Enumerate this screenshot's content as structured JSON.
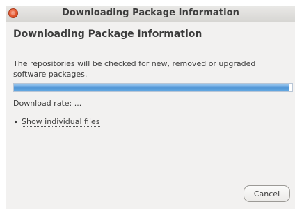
{
  "window": {
    "title": "Downloading Package Information"
  },
  "main": {
    "heading": "Downloading Package Information",
    "description": "The repositories will be checked for new, removed or upgraded software packages.",
    "progress": 0.99,
    "download_rate_label": "Download rate:",
    "download_rate_value": "...",
    "expander_label": "Show individual files"
  },
  "buttons": {
    "cancel_label": "Cancel"
  },
  "colors": {
    "progress_fill": "#5fa0dc",
    "close_button": "#e0532a"
  }
}
